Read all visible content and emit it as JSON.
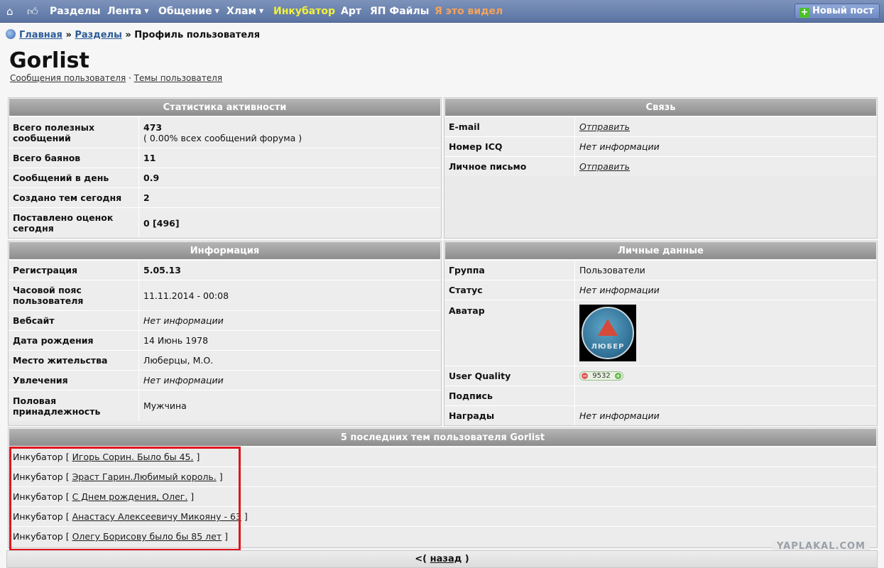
{
  "nav": {
    "home_icon": "home-icon",
    "like_icon": "thumbs-up-icon",
    "items": [
      {
        "label": "Разделы",
        "dropdown": false
      },
      {
        "label": "Лента",
        "dropdown": true
      },
      {
        "label": "Общение",
        "dropdown": true
      },
      {
        "label": "Хлам",
        "dropdown": true
      },
      {
        "label": "Инкубатор",
        "dropdown": false
      },
      {
        "label": "Арт",
        "dropdown": false
      },
      {
        "label": "ЯП Файлы",
        "dropdown": false
      },
      {
        "label": "Я это видел",
        "dropdown": false
      }
    ],
    "new_post": "Новый пост"
  },
  "breadcrumb": {
    "home": "Главная",
    "sep": "»",
    "sections": "Разделы",
    "current": "Профиль пользователя"
  },
  "profile": {
    "username": "Gorlist",
    "links": {
      "messages": "Сообщения пользователя",
      "dot": "·",
      "topics": "Темы пользователя"
    }
  },
  "stats": {
    "title": "Статистика активности",
    "rows": [
      {
        "label": "Всего полезных сообщений",
        "value": "473",
        "sub": "( 0.00% всех сообщений форума )"
      },
      {
        "label": "Всего баянов",
        "value": "11"
      },
      {
        "label": "Сообщений в день",
        "value": "0.9"
      },
      {
        "label": "Создано тем сегодня",
        "value": "2"
      },
      {
        "label": "Поставлено оценок сегодня",
        "value": "0 [496]"
      }
    ]
  },
  "contact": {
    "title": "Связь",
    "rows": [
      {
        "label": "E-mail",
        "value": "Отправить"
      },
      {
        "label": "Номер ICQ",
        "value": "Нет информации"
      },
      {
        "label": "Личное письмо",
        "value": "Отправить"
      }
    ]
  },
  "info": {
    "title": "Информация",
    "rows": [
      {
        "label": "Регистрация",
        "value": "5.05.13"
      },
      {
        "label": "Часовой пояс пользователя",
        "value": "11.11.2014 - 00:08"
      },
      {
        "label": "Вебсайт",
        "value": "Нет информации"
      },
      {
        "label": "Дата рождения",
        "value": "14 Июнь 1978"
      },
      {
        "label": "Место жительства",
        "value": "Люберцы, М.О."
      },
      {
        "label": "Увлечения",
        "value": "Нет информации"
      },
      {
        "label": "Половая принадлежность",
        "value": "Мужчина"
      }
    ]
  },
  "personal": {
    "title": "Личные данные",
    "rows": [
      {
        "label": "Группа",
        "value": "Пользователи"
      },
      {
        "label": "Статус",
        "value": "Нет информации"
      },
      {
        "label": "Аватар",
        "value": "ЛЮБЕР"
      },
      {
        "label": "User Quality",
        "value": "9532"
      },
      {
        "label": "Подпись",
        "value": ""
      },
      {
        "label": "Награды",
        "value": "Нет информации"
      }
    ]
  },
  "topics": {
    "title": "5 последних тем пользователя Gorlist",
    "items": [
      {
        "section": "Инкубатор",
        "open": "[",
        "title": "Игорь Сорин. Было бы 45.",
        "close": "]"
      },
      {
        "section": "Инкубатор",
        "open": "[",
        "title": "Эраст Гарин.Любимый король.",
        "close": "]"
      },
      {
        "section": "Инкубатор",
        "open": "[",
        "title": "С Днем рождения, Олег.",
        "close": "]"
      },
      {
        "section": "Инкубатор",
        "open": "[",
        "title": "Анастасу Алексеевичу Микояну - 63",
        "close": "]"
      },
      {
        "section": "Инкубатор",
        "open": "[",
        "title": "Олегу Борисову было бы 85 лет",
        "close": "]"
      }
    ]
  },
  "footer": {
    "prefix": "<(",
    "back": "назад",
    "suffix": ")"
  },
  "watermark": "YAPLAKAL.COM"
}
